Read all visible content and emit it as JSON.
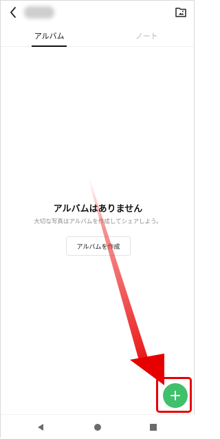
{
  "header": {
    "back_icon": "chevron-left-icon",
    "gallery_icon": "photo-album-icon"
  },
  "tabs": [
    {
      "label": "アルバム",
      "active": true
    },
    {
      "label": "ノート",
      "active": false
    }
  ],
  "empty_state": {
    "title": "アルバムはありません",
    "subtitle": "大切な写真はアルバムを作成してシェアしよう。",
    "create_button_label": "アルバムを作成"
  },
  "fab": {
    "icon": "plus-icon",
    "color": "#3fc06a"
  },
  "annotation": {
    "arrow_color": "#e60000",
    "highlight_color": "#e60000"
  },
  "system_nav": {
    "back_icon": "triangle-back-icon",
    "home_icon": "circle-home-icon",
    "recent_icon": "square-recent-icon"
  }
}
